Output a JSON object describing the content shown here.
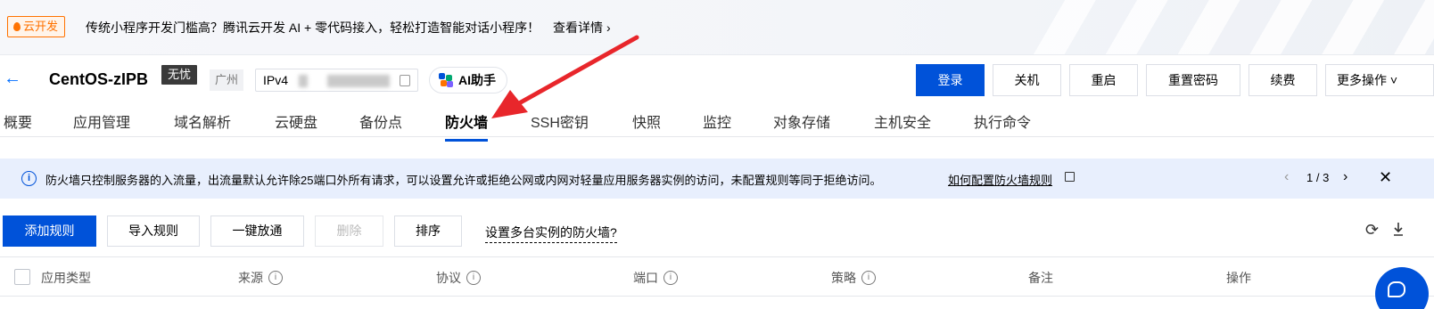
{
  "promo": {
    "tag": "云开发",
    "text": "传统小程序开发门槛高？腾讯云开发 AI + 零代码接入，轻松打造智能对话小程序！",
    "link": "查看详情"
  },
  "instance": {
    "name": "CentOS-zIPB",
    "badge": "无忧",
    "region": "广州",
    "ip_label": "IPv4",
    "ai_button": "AI助手"
  },
  "actions": [
    "登录",
    "关机",
    "重启",
    "重置密码",
    "续费",
    "更多操作"
  ],
  "tabs": [
    "概要",
    "应用管理",
    "域名解析",
    "云硬盘",
    "备份点",
    "防火墙",
    "SSH密钥",
    "快照",
    "监控",
    "对象存储",
    "主机安全",
    "执行命令"
  ],
  "active_tab": "防火墙",
  "info": {
    "text": "防火墙只控制服务器的入流量，出流量默认允许除25端口外所有请求，可以设置允许或拒绝公网或内网对轻量应用服务器实例的访问，未配置规则等同于拒绝访问。",
    "link": "如何配置防火墙规则",
    "pager": "1 / 3"
  },
  "toolbar": {
    "add": "添加规则",
    "import": "导入规则",
    "one_click": "一键放通",
    "delete": "删除",
    "sort": "排序",
    "multi_link": "设置多台实例的防火墙?"
  },
  "table": {
    "columns": [
      "应用类型",
      "来源",
      "协议",
      "端口",
      "策略",
      "备注",
      "操作"
    ]
  },
  "colors": {
    "primary": "#0052d9",
    "promo_tag": "#ff7200",
    "arrow": "#e8262b",
    "info_bg": "#e8effd"
  }
}
